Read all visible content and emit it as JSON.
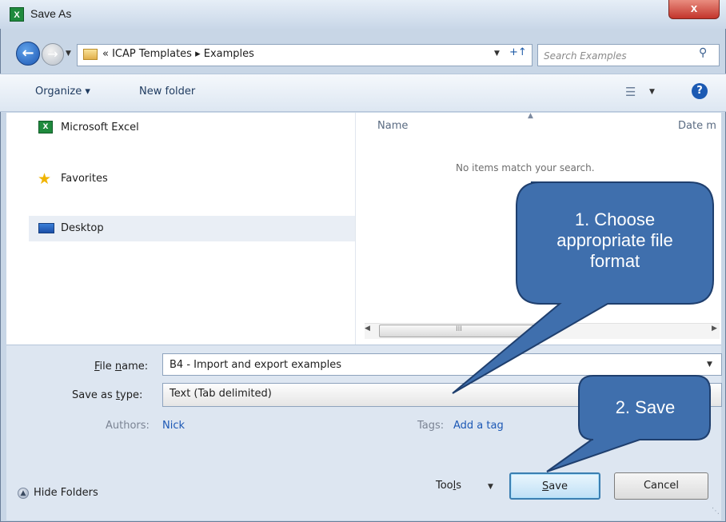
{
  "window": {
    "title": "Save As",
    "app_icon_glyph": "X",
    "close_glyph": "x"
  },
  "address": {
    "path_text": "« ICAP Templates ▸ Examples",
    "refresh_glyph": "+↑"
  },
  "search": {
    "placeholder": "Search Examples"
  },
  "toolbar": {
    "organize_label": "Organize ▾",
    "new_folder_label": "New folder",
    "help_glyph": "?"
  },
  "nav_pane": {
    "items": [
      {
        "label": "Microsoft Excel",
        "icon": "excel-icon"
      },
      {
        "label": "Favorites",
        "icon": "star-icon"
      },
      {
        "label": "Desktop",
        "icon": "desktop-icon",
        "selected": true
      }
    ]
  },
  "content": {
    "columns": [
      "Name",
      "Date m"
    ],
    "empty_message": "No items match your search.",
    "scroll_grip": "III"
  },
  "form": {
    "file_name_label": "File name:",
    "file_name_value": "B4 - Import and export examples",
    "save_type_label": "Save as type:",
    "save_type_value": "Text (Tab delimited)",
    "authors_label": "Authors:",
    "authors_value": "Nick",
    "tags_label": "Tags:",
    "tags_value": "Add a tag"
  },
  "footer": {
    "hide_folders_label": "Hide Folders",
    "tools_label": "Tools",
    "save_label": "Save",
    "cancel_label": "Cancel"
  },
  "callouts": {
    "choose_format": [
      "1. Choose",
      "appropriate file",
      "format"
    ],
    "save": "2. Save",
    "fill_color": "#3f6fad",
    "border_color": "#1f3f6e"
  }
}
